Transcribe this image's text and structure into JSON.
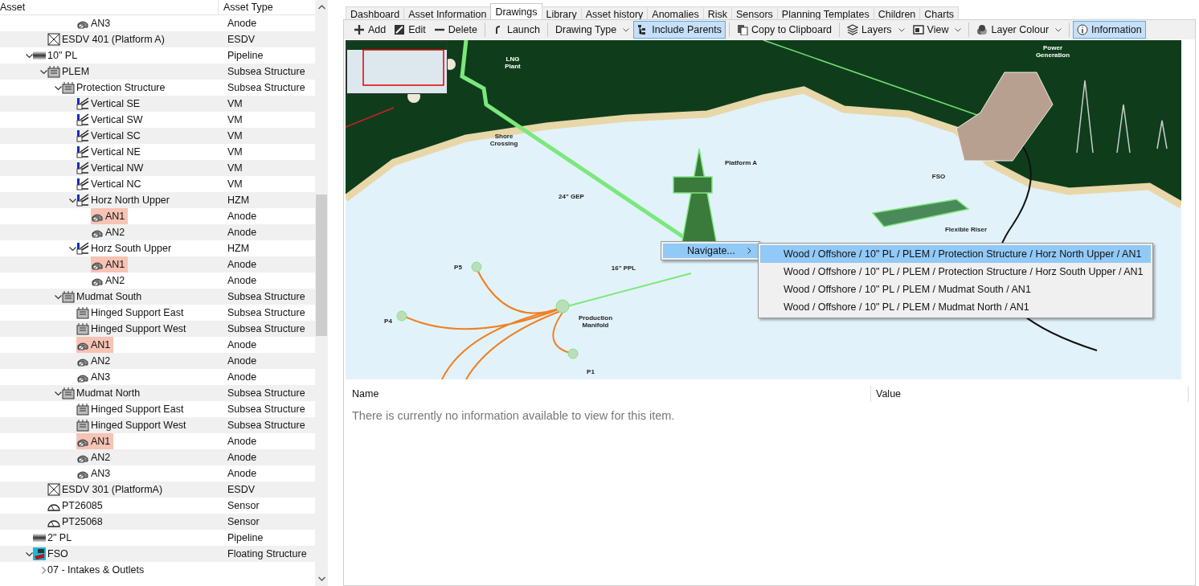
{
  "tree": {
    "columns": [
      "Asset",
      "Asset Type"
    ],
    "nodes": [
      {
        "children": [
          {
            "children": [
              {
                "children": [
                  {
                    "children": [
                      {
                        "children": [
                          {
                            "label": "AN3",
                            "type": "Anode",
                            "kind": "anode",
                            "highlighted": false
                          }
                        ]
                      }
                    ]
                  },
                  {
                    "label": "ESDV 401 (Platform A)",
                    "type": "ESDV",
                    "kind": "esdv",
                    "highlighted": false
                  }
                ]
              },
              {
                "label": "10\" PL",
                "type": "Pipeline",
                "kind": "pipeline",
                "expanded": true,
                "highlighted": false,
                "children": [
                  {
                    "label": "PLEM",
                    "type": "Subsea Structure",
                    "kind": "structure",
                    "expanded": true,
                    "highlighted": false,
                    "children": [
                      {
                        "label": "Protection Structure",
                        "type": "Subsea Structure",
                        "kind": "structure",
                        "expanded": true,
                        "highlighted": false,
                        "children": [
                          {
                            "label": "Vertical SE",
                            "type": "VM",
                            "kind": "member",
                            "highlighted": false
                          },
                          {
                            "label": "Vertical SW",
                            "type": "VM",
                            "kind": "member",
                            "highlighted": false
                          },
                          {
                            "label": "Vertical SC",
                            "type": "VM",
                            "kind": "member",
                            "highlighted": false
                          },
                          {
                            "label": "Vertical NE",
                            "type": "VM",
                            "kind": "member",
                            "highlighted": false
                          },
                          {
                            "label": "Vertical NW",
                            "type": "VM",
                            "kind": "member",
                            "highlighted": false
                          },
                          {
                            "label": "Vertical NC",
                            "type": "VM",
                            "kind": "member",
                            "highlighted": false
                          },
                          {
                            "label": "Horz North Upper",
                            "type": "HZM",
                            "kind": "member",
                            "expanded": true,
                            "highlighted": false,
                            "children": [
                              {
                                "label": "AN1",
                                "type": "Anode",
                                "kind": "anode",
                                "highlighted": true
                              },
                              {
                                "label": "AN2",
                                "type": "Anode",
                                "kind": "anode",
                                "highlighted": false
                              }
                            ]
                          },
                          {
                            "label": "Horz South Upper",
                            "type": "HZM",
                            "kind": "member",
                            "expanded": true,
                            "highlighted": false,
                            "children": [
                              {
                                "label": "AN1",
                                "type": "Anode",
                                "kind": "anode",
                                "highlighted": true
                              },
                              {
                                "label": "AN2",
                                "type": "Anode",
                                "kind": "anode",
                                "highlighted": false
                              }
                            ]
                          }
                        ]
                      },
                      {
                        "label": "Mudmat South",
                        "type": "Subsea Structure",
                        "kind": "structure",
                        "expanded": true,
                        "highlighted": false,
                        "children": [
                          {
                            "label": "Hinged Support East",
                            "type": "Subsea Structure",
                            "kind": "structure",
                            "highlighted": false
                          },
                          {
                            "label": "Hinged Support West",
                            "type": "Subsea Structure",
                            "kind": "structure",
                            "highlighted": false
                          },
                          {
                            "label": "AN1",
                            "type": "Anode",
                            "kind": "anode",
                            "highlighted": true
                          },
                          {
                            "label": "AN2",
                            "type": "Anode",
                            "kind": "anode",
                            "highlighted": false
                          },
                          {
                            "label": "AN3",
                            "type": "Anode",
                            "kind": "anode",
                            "highlighted": false
                          }
                        ]
                      },
                      {
                        "label": "Mudmat North",
                        "type": "Subsea Structure",
                        "kind": "structure",
                        "expanded": true,
                        "highlighted": false,
                        "children": [
                          {
                            "label": "Hinged Support East",
                            "type": "Subsea Structure",
                            "kind": "structure",
                            "highlighted": false
                          },
                          {
                            "label": "Hinged Support West",
                            "type": "Subsea Structure",
                            "kind": "structure",
                            "highlighted": false
                          },
                          {
                            "label": "AN1",
                            "type": "Anode",
                            "kind": "anode",
                            "highlighted": true
                          },
                          {
                            "label": "AN2",
                            "type": "Anode",
                            "kind": "anode",
                            "highlighted": false
                          },
                          {
                            "label": "AN3",
                            "type": "Anode",
                            "kind": "anode",
                            "highlighted": false
                          }
                        ]
                      }
                    ]
                  },
                  {
                    "label": "ESDV 301 (PlatformA)",
                    "type": "ESDV",
                    "kind": "esdv",
                    "highlighted": false
                  },
                  {
                    "label": "PT26085",
                    "type": "Sensor",
                    "kind": "sensor",
                    "highlighted": false
                  },
                  {
                    "label": "PT25068",
                    "type": "Sensor",
                    "kind": "sensor",
                    "highlighted": false
                  }
                ]
              },
              {
                "label": "2\" PL",
                "type": "Pipeline",
                "kind": "pipeline",
                "highlighted": false
              },
              {
                "label": "FSO",
                "type": "Floating Structure",
                "kind": "fso",
                "expanded": true,
                "highlighted": false,
                "children": [
                  {
                    "label": "07 - Intakes & Outlets",
                    "expanded": false,
                    "highlighted": false
                  }
                ]
              }
            ]
          }
        ]
      }
    ]
  },
  "tabs": [
    {
      "label": "Dashboard",
      "selected": false
    },
    {
      "label": "Asset Information",
      "selected": false
    },
    {
      "label": "Drawings",
      "selected": true
    },
    {
      "label": "Library",
      "selected": false
    },
    {
      "label": "Asset history",
      "selected": false
    },
    {
      "label": "Anomalies",
      "selected": false
    },
    {
      "label": "Risk",
      "selected": false
    },
    {
      "label": "Sensors",
      "selected": false
    },
    {
      "label": "Planning Templates",
      "selected": false
    },
    {
      "label": "Children",
      "selected": false
    },
    {
      "label": "Charts",
      "selected": false
    }
  ],
  "toolbar": [
    [
      {
        "label": "Add",
        "kind": "button",
        "on": false
      },
      {
        "label": "Edit",
        "kind": "button",
        "on": false
      },
      {
        "label": "Delete",
        "kind": "button",
        "on": false
      }
    ],
    [
      {
        "label": "Launch",
        "kind": "button",
        "on": false
      }
    ],
    [
      {
        "label": "Drawing Type",
        "kind": "dropdown",
        "on": false
      },
      {
        "label": "Include Parents",
        "kind": "button",
        "on": true
      }
    ],
    [
      {
        "label": "Copy to Clipboard",
        "kind": "button",
        "on": false
      }
    ],
    [
      {
        "label": "Layers",
        "kind": "dropdown",
        "on": false
      },
      {
        "label": "View",
        "kind": "dropdown",
        "on": false
      }
    ],
    [
      {
        "label": "Layer Colour",
        "kind": "dropdown",
        "on": false
      }
    ],
    [
      {
        "label": "Information",
        "kind": "button",
        "on": true
      }
    ]
  ],
  "map": {
    "labels": [
      "LNG Plant",
      "Power Generation",
      "Shore Crossing",
      "Platform A",
      "24\" GEP",
      "FSO",
      "Flexible Riser",
      "16\" PPL",
      "P5",
      "P4",
      "Production Manifold",
      "P1"
    ]
  },
  "context_menu": {
    "item": "Navigate...",
    "submenu": [
      {
        "label": "Wood / Offshore / 10\" PL / PLEM / Protection Structure / Horz North Upper / AN1",
        "selected": true
      },
      {
        "label": "Wood / Offshore / 10\" PL / PLEM / Protection Structure / Horz South Upper / AN1",
        "selected": false
      },
      {
        "label": "Wood / Offshore / 10\" PL / PLEM / Mudmat South / AN1",
        "selected": false
      },
      {
        "label": "Wood / Offshore / 10\" PL / PLEM / Mudmat North / AN1",
        "selected": false
      }
    ]
  },
  "info": {
    "columns": [
      "Name",
      "Value"
    ],
    "message": "There is currently no information available to view for this item."
  }
}
